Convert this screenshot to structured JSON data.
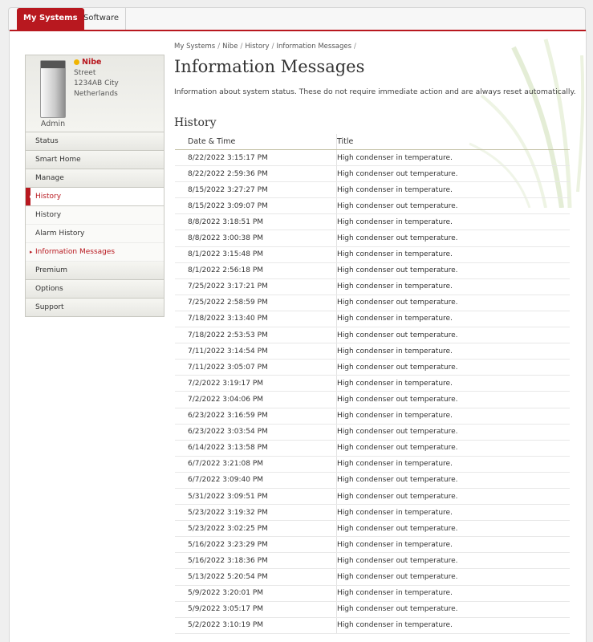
{
  "tabs": {
    "my_systems": "My Systems",
    "software": "Software"
  },
  "system": {
    "name": "Nibe",
    "street": "Street",
    "city": "1234AB City",
    "country": "Netherlands",
    "role": "Admin"
  },
  "menu": {
    "status": "Status",
    "smart_home": "Smart Home",
    "manage": "Manage",
    "history": "History",
    "sub_history": "History",
    "sub_alarm_history": "Alarm History",
    "sub_information_messages": "Information Messages",
    "premium": "Premium",
    "options": "Options",
    "support": "Support"
  },
  "breadcrumb": [
    "My Systems",
    "Nibe",
    "History",
    "Information Messages"
  ],
  "page": {
    "title": "Information Messages",
    "description": "Information about system status. These do not require immediate action and are always reset automatically.",
    "section": "History"
  },
  "table": {
    "headers": {
      "datetime": "Date & Time",
      "title": "Title"
    },
    "rows": [
      {
        "datetime": "8/22/2022 3:15:17 PM",
        "title": "High condenser in temperature."
      },
      {
        "datetime": "8/22/2022 2:59:36 PM",
        "title": "High condenser out temperature."
      },
      {
        "datetime": "8/15/2022 3:27:27 PM",
        "title": "High condenser in temperature."
      },
      {
        "datetime": "8/15/2022 3:09:07 PM",
        "title": "High condenser out temperature."
      },
      {
        "datetime": "8/8/2022 3:18:51 PM",
        "title": "High condenser in temperature."
      },
      {
        "datetime": "8/8/2022 3:00:38 PM",
        "title": "High condenser out temperature."
      },
      {
        "datetime": "8/1/2022 3:15:48 PM",
        "title": "High condenser in temperature."
      },
      {
        "datetime": "8/1/2022 2:56:18 PM",
        "title": "High condenser out temperature."
      },
      {
        "datetime": "7/25/2022 3:17:21 PM",
        "title": "High condenser in temperature."
      },
      {
        "datetime": "7/25/2022 2:58:59 PM",
        "title": "High condenser out temperature."
      },
      {
        "datetime": "7/18/2022 3:13:40 PM",
        "title": "High condenser in temperature."
      },
      {
        "datetime": "7/18/2022 2:53:53 PM",
        "title": "High condenser out temperature."
      },
      {
        "datetime": "7/11/2022 3:14:54 PM",
        "title": "High condenser in temperature."
      },
      {
        "datetime": "7/11/2022 3:05:07 PM",
        "title": "High condenser out temperature."
      },
      {
        "datetime": "7/2/2022 3:19:17 PM",
        "title": "High condenser in temperature."
      },
      {
        "datetime": "7/2/2022 3:04:06 PM",
        "title": "High condenser out temperature."
      },
      {
        "datetime": "6/23/2022 3:16:59 PM",
        "title": "High condenser in temperature."
      },
      {
        "datetime": "6/23/2022 3:03:54 PM",
        "title": "High condenser out temperature."
      },
      {
        "datetime": "6/14/2022 3:13:58 PM",
        "title": "High condenser out temperature."
      },
      {
        "datetime": "6/7/2022 3:21:08 PM",
        "title": "High condenser in temperature."
      },
      {
        "datetime": "6/7/2022 3:09:40 PM",
        "title": "High condenser out temperature."
      },
      {
        "datetime": "5/31/2022 3:09:51 PM",
        "title": "High condenser out temperature."
      },
      {
        "datetime": "5/23/2022 3:19:32 PM",
        "title": "High condenser in temperature."
      },
      {
        "datetime": "5/23/2022 3:02:25 PM",
        "title": "High condenser out temperature."
      },
      {
        "datetime": "5/16/2022 3:23:29 PM",
        "title": "High condenser in temperature."
      },
      {
        "datetime": "5/16/2022 3:18:36 PM",
        "title": "High condenser out temperature."
      },
      {
        "datetime": "5/13/2022 5:20:54 PM",
        "title": "High condenser out temperature."
      },
      {
        "datetime": "5/9/2022 3:20:01 PM",
        "title": "High condenser in temperature."
      },
      {
        "datetime": "5/9/2022 3:05:17 PM",
        "title": "High condenser out temperature."
      },
      {
        "datetime": "5/2/2022 3:10:19 PM",
        "title": "High condenser in temperature."
      }
    ]
  },
  "colors": {
    "brand_red": "#b8181f",
    "status_dot": "#f0b400"
  }
}
